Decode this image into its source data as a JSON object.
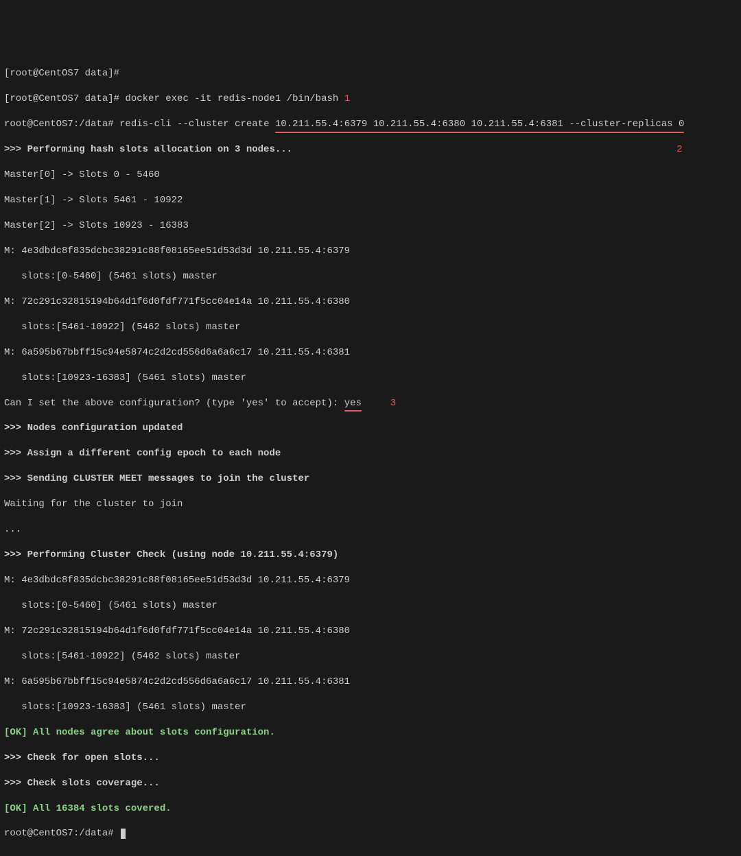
{
  "lines": {
    "l1": "[root@CentOS7 data]#",
    "l2_prompt": "[root@CentOS7 data]# ",
    "l2_cmd": "docker exec -it redis-node1 /bin/bash",
    "ann1": " 1",
    "l3_prompt": "root@CentOS7:/data# ",
    "l3_cmd_a": "redis-cli --cluster create ",
    "l3_cmd_b": "10.211.55.4:6379 10.211.55.4:6380 10.211.55.4:6381 --cluster-replicas 0",
    "ann2": "2",
    "l4": ">>> Performing hash slots allocation on 3 nodes...",
    "l5": "Master[0] -> Slots 0 - 5460",
    "l6": "Master[1] -> Slots 5461 - 10922",
    "l7": "Master[2] -> Slots 10923 - 16383",
    "l8": "M: 4e3dbdc8f835dcbc38291c88f08165ee51d53d3d 10.211.55.4:6379",
    "l9": "   slots:[0-5460] (5461 slots) master",
    "l10": "M: 72c291c32815194b64d1f6d0fdf771f5cc04e14a 10.211.55.4:6380",
    "l11": "   slots:[5461-10922] (5462 slots) master",
    "l12": "M: 6a595b67bbff15c94e5874c2d2cd556d6a6a6c17 10.211.55.4:6381",
    "l13": "   slots:[10923-16383] (5461 slots) master",
    "l14_a": "Can I set the above configuration? (type 'yes' to accept): ",
    "l14_b": "yes",
    "ann3": "3",
    "l15": ">>> Nodes configuration updated",
    "l16": ">>> Assign a different config epoch to each node",
    "l17": ">>> Sending CLUSTER MEET messages to join the cluster",
    "l18": "Waiting for the cluster to join",
    "l19": "...",
    "l20": ">>> Performing Cluster Check (using node 10.211.55.4:6379)",
    "l21": "M: 4e3dbdc8f835dcbc38291c88f08165ee51d53d3d 10.211.55.4:6379",
    "l22": "   slots:[0-5460] (5461 slots) master",
    "l23": "M: 72c291c32815194b64d1f6d0fdf771f5cc04e14a 10.211.55.4:6380",
    "l24": "   slots:[5461-10922] (5462 slots) master",
    "l25": "M: 6a595b67bbff15c94e5874c2d2cd556d6a6a6c17 10.211.55.4:6381",
    "l26": "   slots:[10923-16383] (5461 slots) master",
    "l27": "[OK] All nodes agree about slots configuration.",
    "l28": ">>> Check for open slots...",
    "l29": ">>> Check slots coverage...",
    "l30": "[OK] All 16384 slots covered.",
    "l31_prompt": "root@CentOS7:/data# "
  }
}
